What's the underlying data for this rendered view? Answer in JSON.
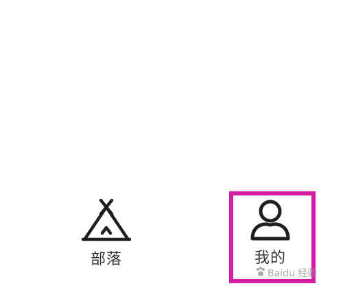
{
  "tabs": [
    {
      "label": "部落",
      "icon": "tent-icon"
    },
    {
      "label": "我的",
      "icon": "user-icon"
    }
  ],
  "watermark": {
    "text": "Baidu 经验"
  },
  "colors": {
    "highlight": "#d21da4",
    "icon": "#1e1e1e",
    "label": "#333333",
    "background": "#ffffff"
  }
}
